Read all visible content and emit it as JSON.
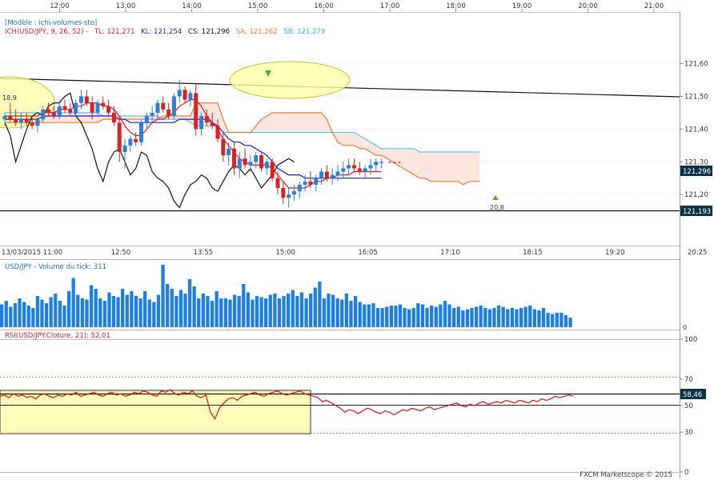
{
  "header": {
    "model": "[Modèle : ichi-volumes-sto]",
    "ich_prefix": "ICH(USD/JPY, 9, 26, 52) -",
    "ich_tl": "TL: 121,271",
    "ich_kl": "KL: 121,254",
    "ich_cs": "CS: 121,296",
    "ich_sa": "SA: 121,262",
    "ich_sb": "SB: 121,279"
  },
  "volume_label": "USD/JPY - Volume du tick: 311",
  "rsi_label": "RSI(USD/JPY.Cloture, 21): 52,01",
  "footer": "FXCM Marketscope © 2015",
  "top_times": [
    "12:00",
    "13:00",
    "14:00",
    "15:00",
    "16:00",
    "17:00",
    "18:00",
    "19:00",
    "20:00",
    "21:00"
  ],
  "bottom_times": [
    "13/03/2015 11:00",
    "12:50",
    "13:55",
    "15:00",
    "16:05",
    "17:10",
    "18:15",
    "19:20",
    "20:25"
  ],
  "markers": {
    "left": "18,9",
    "right": "20,8"
  },
  "colors": {
    "up": "#2f7fd6",
    "down": "#d42525",
    "tenkan": "#e01a1a",
    "kijun": "#1a1ad4",
    "chikou": "#111111",
    "senkou_a": "#f07a3a",
    "senkou_b": "#5cc8ea",
    "cloud": "#fde6e0",
    "volume": "#1f7fe0",
    "rsi": "#dd1111",
    "highlight": "#ffffaa",
    "grid": "#e3e3e3",
    "tag": "#083248"
  },
  "chart_data": [
    {
      "type": "candlestick",
      "title": "USD/JPY",
      "y_ticks": [
        "121,60",
        "121,50",
        "121,40",
        "121,30",
        "121,20"
      ],
      "ylim": [
        121.11,
        121.66
      ],
      "last_price": "121,296",
      "horizontal_level": "121,193",
      "candles": [
        [
          121.43,
          121.45,
          121.41,
          121.44
        ],
        [
          121.44,
          121.48,
          121.42,
          121.43
        ],
        [
          121.43,
          121.46,
          121.41,
          121.42
        ],
        [
          121.42,
          121.45,
          121.4,
          121.43
        ],
        [
          121.43,
          121.45,
          121.41,
          121.42
        ],
        [
          121.42,
          121.44,
          121.4,
          121.41
        ],
        [
          121.41,
          121.44,
          121.39,
          121.43
        ],
        [
          121.43,
          121.47,
          121.42,
          121.46
        ],
        [
          121.46,
          121.48,
          121.44,
          121.45
        ],
        [
          121.45,
          121.47,
          121.43,
          121.44
        ],
        [
          121.44,
          121.49,
          121.43,
          121.47
        ],
        [
          121.47,
          121.49,
          121.45,
          121.46
        ],
        [
          121.46,
          121.48,
          121.44,
          121.45
        ],
        [
          121.45,
          121.49,
          121.44,
          121.48
        ],
        [
          121.48,
          121.52,
          121.46,
          121.5
        ],
        [
          121.5,
          121.52,
          121.47,
          121.48
        ],
        [
          121.48,
          121.5,
          121.43,
          121.45
        ],
        [
          121.45,
          121.49,
          121.44,
          121.48
        ],
        [
          121.48,
          121.5,
          121.46,
          121.47
        ],
        [
          121.47,
          121.49,
          121.44,
          121.45
        ],
        [
          121.45,
          121.47,
          121.41,
          121.42
        ],
        [
          121.42,
          121.44,
          121.3,
          121.33
        ],
        [
          121.33,
          121.37,
          121.28,
          121.35
        ],
        [
          121.35,
          121.38,
          121.33,
          121.37
        ],
        [
          121.37,
          121.39,
          121.35,
          121.36
        ],
        [
          121.36,
          121.43,
          121.35,
          121.42
        ],
        [
          121.42,
          121.45,
          121.4,
          121.44
        ],
        [
          121.44,
          121.47,
          121.42,
          121.45
        ],
        [
          121.45,
          121.49,
          121.43,
          121.48
        ],
        [
          121.48,
          121.5,
          121.45,
          121.46
        ],
        [
          121.46,
          121.48,
          121.43,
          121.44
        ],
        [
          121.44,
          121.51,
          121.43,
          121.5
        ],
        [
          121.5,
          121.55,
          121.48,
          121.52
        ],
        [
          121.52,
          121.53,
          121.48,
          121.49
        ],
        [
          121.49,
          121.52,
          121.47,
          121.51
        ],
        [
          121.51,
          121.54,
          121.38,
          121.4
        ],
        [
          121.4,
          121.45,
          121.38,
          121.44
        ],
        [
          121.44,
          121.46,
          121.41,
          121.42
        ],
        [
          121.42,
          121.45,
          121.4,
          121.41
        ],
        [
          121.41,
          121.43,
          121.36,
          121.37
        ],
        [
          121.37,
          121.39,
          121.3,
          121.32
        ],
        [
          121.32,
          121.36,
          121.29,
          121.34
        ],
        [
          121.34,
          121.36,
          121.26,
          121.28
        ],
        [
          121.28,
          121.33,
          121.25,
          121.31
        ],
        [
          121.31,
          121.34,
          121.28,
          121.29
        ],
        [
          121.29,
          121.32,
          121.27,
          121.3
        ],
        [
          121.3,
          121.33,
          121.28,
          121.32
        ],
        [
          121.32,
          121.33,
          121.27,
          121.28
        ],
        [
          121.28,
          121.31,
          121.26,
          121.3
        ],
        [
          121.3,
          121.31,
          121.24,
          121.25
        ],
        [
          121.25,
          121.27,
          121.2,
          121.22
        ],
        [
          121.22,
          121.24,
          121.17,
          121.19
        ],
        [
          121.19,
          121.22,
          121.16,
          121.2
        ],
        [
          121.2,
          121.23,
          121.18,
          121.21
        ],
        [
          121.21,
          121.24,
          121.19,
          121.23
        ],
        [
          121.23,
          121.26,
          121.21,
          121.24
        ],
        [
          121.24,
          121.27,
          121.22,
          121.23
        ],
        [
          121.23,
          121.26,
          121.21,
          121.25
        ],
        [
          121.25,
          121.28,
          121.23,
          121.27
        ],
        [
          121.27,
          121.29,
          121.24,
          121.25
        ],
        [
          121.25,
          121.28,
          121.23,
          121.26
        ],
        [
          121.26,
          121.29,
          121.24,
          121.27
        ],
        [
          121.27,
          121.3,
          121.25,
          121.28
        ],
        [
          121.28,
          121.31,
          121.26,
          121.29
        ],
        [
          121.29,
          121.31,
          121.27,
          121.28
        ],
        [
          121.28,
          121.3,
          121.26,
          121.27
        ],
        [
          121.27,
          121.29,
          121.25,
          121.28
        ],
        [
          121.28,
          121.31,
          121.26,
          121.29
        ],
        [
          121.29,
          121.31,
          121.27,
          121.3
        ],
        [
          121.3,
          121.31,
          121.28,
          121.3
        ]
      ],
      "series": [
        {
          "name": "TL",
          "values": [
            121.44,
            121.44,
            121.44,
            121.44,
            121.44,
            121.44,
            121.44,
            121.45,
            121.45,
            121.45,
            121.46,
            121.46,
            121.46,
            121.47,
            121.47,
            121.48,
            121.48,
            121.48,
            121.47,
            121.47,
            121.46,
            121.44,
            121.41,
            121.39,
            121.38,
            121.38,
            121.4,
            121.42,
            121.43,
            121.43,
            121.44,
            121.45,
            121.47,
            121.48,
            121.49,
            121.49,
            121.47,
            121.44,
            121.42,
            121.4,
            121.37,
            121.35,
            121.33,
            121.31,
            121.3,
            121.29,
            121.29,
            121.29,
            121.29,
            121.28,
            121.26,
            121.24,
            121.22,
            121.22,
            121.22,
            121.22,
            121.23,
            121.24,
            121.24,
            121.25,
            121.25,
            121.26,
            121.26,
            121.26,
            121.27,
            121.27,
            121.27,
            121.27,
            121.27,
            121.27
          ]
        },
        {
          "name": "KL",
          "values": [
            121.43,
            121.43,
            121.43,
            121.43,
            121.43,
            121.43,
            121.43,
            121.44,
            121.44,
            121.44,
            121.44,
            121.44,
            121.44,
            121.44,
            121.44,
            121.44,
            121.44,
            121.44,
            121.44,
            121.44,
            121.44,
            121.43,
            121.43,
            121.42,
            121.42,
            121.42,
            121.42,
            121.42,
            121.42,
            121.42,
            121.42,
            121.42,
            121.43,
            121.43,
            121.43,
            121.43,
            121.43,
            121.43,
            121.42,
            121.41,
            121.39,
            121.37,
            121.36,
            121.36,
            121.35,
            121.35,
            121.34,
            121.33,
            121.32,
            121.3,
            121.28,
            121.27,
            121.26,
            121.26,
            121.26,
            121.25,
            121.25,
            121.25,
            121.25,
            121.25,
            121.25,
            121.25,
            121.25,
            121.25,
            121.25,
            121.25,
            121.25,
            121.25,
            121.25,
            121.25
          ]
        },
        {
          "name": "SA",
          "values": [
            121.42,
            121.42,
            121.42,
            121.42,
            121.42,
            121.42,
            121.42,
            121.42,
            121.42,
            121.42,
            121.42,
            121.42,
            121.42,
            121.42,
            121.42,
            121.42,
            121.42,
            121.42,
            121.43,
            121.43,
            121.43,
            121.43,
            121.43,
            121.43,
            121.43,
            121.43,
            121.43,
            121.43,
            121.43,
            121.44,
            121.44,
            121.44,
            121.44,
            121.44,
            121.44,
            121.48,
            121.48,
            121.48,
            121.48,
            121.48,
            121.43,
            121.39,
            121.39,
            121.39,
            121.39,
            121.39,
            121.41,
            121.43,
            121.44,
            121.45,
            121.45,
            121.45,
            121.45,
            121.45,
            121.45,
            121.45,
            121.45,
            121.45,
            121.45,
            121.43,
            121.39,
            121.36,
            121.35,
            121.35,
            121.35,
            121.34,
            121.34,
            121.33,
            121.32,
            121.32,
            121.31,
            121.3,
            121.29,
            121.28,
            121.27,
            121.26,
            121.25,
            121.25,
            121.24,
            121.24,
            121.24,
            121.24,
            121.24,
            121.24,
            121.23,
            121.24,
            121.24,
            121.24
          ]
        },
        {
          "name": "SB",
          "values": [
            121.45,
            121.45,
            121.45,
            121.45,
            121.45,
            121.45,
            121.45,
            121.45,
            121.45,
            121.45,
            121.45,
            121.45,
            121.45,
            121.45,
            121.45,
            121.45,
            121.45,
            121.45,
            121.44,
            121.44,
            121.44,
            121.44,
            121.44,
            121.44,
            121.44,
            121.44,
            121.44,
            121.44,
            121.44,
            121.43,
            121.43,
            121.43,
            121.43,
            121.43,
            121.42,
            121.41,
            121.41,
            121.41,
            121.41,
            121.41,
            121.39,
            121.39,
            121.39,
            121.39,
            121.39,
            121.39,
            121.39,
            121.39,
            121.39,
            121.39,
            121.39,
            121.39,
            121.39,
            121.39,
            121.39,
            121.39,
            121.39,
            121.39,
            121.39,
            121.39,
            121.39,
            121.39,
            121.39,
            121.39,
            121.39,
            121.38,
            121.37,
            121.36,
            121.35,
            121.34,
            121.34,
            121.34,
            121.34,
            121.34,
            121.34,
            121.34,
            121.33,
            121.33,
            121.33,
            121.33,
            121.33,
            121.33,
            121.33,
            121.33,
            121.33,
            121.33,
            121.33,
            121.33
          ]
        },
        {
          "name": "CS",
          "values": [
            121.42,
            121.38,
            121.3,
            121.35,
            121.4,
            121.44,
            121.45,
            121.44,
            121.47,
            121.48,
            121.48,
            121.5,
            121.51,
            121.44,
            121.42,
            121.38,
            121.34,
            121.28,
            121.24,
            121.3,
            121.33,
            121.34,
            121.3,
            121.26,
            121.28,
            121.33,
            121.32,
            121.27,
            121.25,
            121.24,
            121.22,
            121.18,
            121.16,
            121.2,
            121.23,
            121.24,
            121.26,
            121.25,
            121.22,
            121.21,
            121.24,
            121.27,
            121.29,
            121.28,
            121.26,
            121.28,
            121.25,
            121.22,
            121.24,
            121.26,
            121.29,
            121.3,
            121.31,
            121.3
          ]
        }
      ]
    },
    {
      "type": "bar",
      "title": "USD/JPY - Volume du tick",
      "y_ticks": [
        "0"
      ],
      "values": [
        95,
        110,
        85,
        100,
        120,
        105,
        90,
        80,
        130,
        115,
        100,
        125,
        140,
        110,
        90,
        150,
        205,
        135,
        120,
        115,
        175,
        160,
        120,
        110,
        145,
        130,
        125,
        160,
        135,
        150,
        130,
        120,
        150,
        115,
        105,
        135,
        260,
        180,
        160,
        130,
        155,
        140,
        200,
        170,
        120,
        140,
        130,
        110,
        150,
        120,
        120,
        115,
        135,
        130,
        180,
        145,
        115,
        130,
        125,
        120,
        135,
        140,
        120,
        130,
        140,
        155,
        130,
        145,
        120,
        140,
        165,
        190,
        120,
        140,
        135,
        120,
        115,
        140,
        110,
        130,
        105,
        95,
        95,
        100,
        80,
        80,
        85,
        90,
        90,
        95,
        80,
        75,
        80,
        100,
        95,
        80,
        90,
        85,
        95,
        110,
        95,
        80,
        85,
        70,
        75,
        80,
        85,
        90,
        80,
        75,
        80,
        90,
        85,
        75,
        80,
        75,
        80,
        85,
        90,
        75,
        70,
        80,
        60,
        55,
        60,
        60,
        50,
        40
      ]
    },
    {
      "type": "line",
      "title": "RSI(USD/JPY.Cloture, 21)",
      "ylim": [
        0,
        100
      ],
      "y_ticks": [
        "100",
        "70",
        "50",
        "30",
        "0"
      ],
      "last_value": "58,46",
      "series": [
        {
          "name": "RSI",
          "values": [
            57,
            58,
            56,
            59,
            57,
            58,
            56,
            57,
            55,
            58,
            59,
            57,
            56,
            58,
            57,
            59,
            58,
            60,
            57,
            58,
            59,
            60,
            58,
            57,
            59,
            60,
            58,
            59,
            57,
            58,
            60,
            59,
            61,
            60,
            58,
            57,
            61,
            60,
            62,
            59,
            58,
            60,
            59,
            61,
            57,
            56,
            58,
            45,
            40,
            48,
            52,
            55,
            56,
            54,
            57,
            58,
            59,
            60,
            58,
            57,
            59,
            60,
            61,
            59,
            58,
            59,
            60,
            61,
            59,
            58,
            57,
            56,
            53,
            54,
            52,
            50,
            48,
            45,
            47,
            46,
            44,
            46,
            48,
            47,
            45,
            44,
            46,
            45,
            43,
            45,
            47,
            46,
            48,
            47,
            46,
            48,
            49,
            47,
            48,
            49,
            50,
            51,
            52,
            50,
            49,
            51,
            50,
            52,
            53,
            51,
            52,
            53,
            52,
            54,
            53,
            52,
            54,
            53,
            52,
            54,
            53,
            55,
            54,
            55,
            57,
            56,
            57,
            58,
            57
          ]
        }
      ]
    }
  ]
}
